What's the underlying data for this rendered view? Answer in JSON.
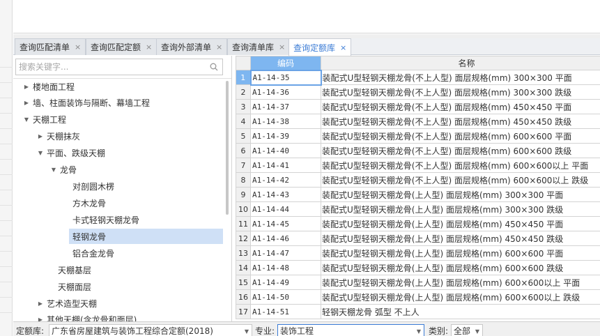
{
  "tabs": [
    {
      "label": "查询匹配清单",
      "close": "×"
    },
    {
      "label": "查询匹配定额",
      "close": "×"
    },
    {
      "label": "查询外部清单",
      "close": "×"
    },
    {
      "label": "查询清单库",
      "close": "×"
    },
    {
      "label": "查询定额库",
      "close": "×",
      "active": true
    }
  ],
  "search": {
    "placeholder": "搜索关键字..."
  },
  "tree": [
    {
      "label": "楼地面工程",
      "expander": "▶"
    },
    {
      "label": "墙、柱面装饰与隔断、幕墙工程",
      "expander": "▶"
    },
    {
      "label": "天棚工程",
      "expander": "▼"
    },
    {
      "label": "天棚抹灰",
      "expander": "▶"
    },
    {
      "label": "平面、跌级天棚",
      "expander": "▼"
    },
    {
      "label": "龙骨",
      "expander": "▼"
    },
    {
      "label": "对剖圆木楞",
      "expander": ""
    },
    {
      "label": "方木龙骨",
      "expander": ""
    },
    {
      "label": "卡式轻钢天棚龙骨",
      "expander": ""
    },
    {
      "label": "轻钢龙骨",
      "expander": "",
      "selected": true
    },
    {
      "label": "铝合金龙骨",
      "expander": ""
    },
    {
      "label": "天棚基层",
      "expander": ""
    },
    {
      "label": "天棚面层",
      "expander": ""
    },
    {
      "label": "艺术造型天棚",
      "expander": "▶"
    },
    {
      "label": "其他天棚(含龙骨和面层)",
      "expander": "▶"
    }
  ],
  "grid": {
    "columns": {
      "code": "编码",
      "name": "名称"
    },
    "rows": [
      {
        "num": "1",
        "code": "A1-14-35",
        "name": "装配式U型轻钢天棚龙骨(不上人型) 面层规格(mm) 300×300 平面"
      },
      {
        "num": "2",
        "code": "A1-14-36",
        "name": "装配式U型轻钢天棚龙骨(不上人型) 面层规格(mm) 300×300 跌级"
      },
      {
        "num": "3",
        "code": "A1-14-37",
        "name": "装配式U型轻钢天棚龙骨(不上人型) 面层规格(mm) 450×450 平面"
      },
      {
        "num": "4",
        "code": "A1-14-38",
        "name": "装配式U型轻钢天棚龙骨(不上人型) 面层规格(mm) 450×450 跌级"
      },
      {
        "num": "5",
        "code": "A1-14-39",
        "name": "装配式U型轻钢天棚龙骨(不上人型) 面层规格(mm) 600×600 平面"
      },
      {
        "num": "6",
        "code": "A1-14-40",
        "name": "装配式U型轻钢天棚龙骨(不上人型) 面层规格(mm) 600×600 跌级"
      },
      {
        "num": "7",
        "code": "A1-14-41",
        "name": "装配式U型轻钢天棚龙骨(不上人型) 面层规格(mm) 600×600以上 平面"
      },
      {
        "num": "8",
        "code": "A1-14-42",
        "name": "装配式U型轻钢天棚龙骨(不上人型) 面层规格(mm) 600×600以上 跌级"
      },
      {
        "num": "9",
        "code": "A1-14-43",
        "name": "装配式U型轻钢天棚龙骨(上人型) 面层规格(mm) 300×300 平面"
      },
      {
        "num": "10",
        "code": "A1-14-44",
        "name": "装配式U型轻钢天棚龙骨(上人型) 面层规格(mm) 300×300 跌级"
      },
      {
        "num": "11",
        "code": "A1-14-45",
        "name": "装配式U型轻钢天棚龙骨(上人型) 面层规格(mm) 450×450 平面"
      },
      {
        "num": "12",
        "code": "A1-14-46",
        "name": "装配式U型轻钢天棚龙骨(上人型) 面层规格(mm) 450×450 跌级"
      },
      {
        "num": "13",
        "code": "A1-14-47",
        "name": "装配式U型轻钢天棚龙骨(上人型) 面层规格(mm) 600×600 平面"
      },
      {
        "num": "14",
        "code": "A1-14-48",
        "name": "装配式U型轻钢天棚龙骨(上人型) 面层规格(mm) 600×600 跌级"
      },
      {
        "num": "15",
        "code": "A1-14-49",
        "name": "装配式U型轻钢天棚龙骨(上人型) 面层规格(mm) 600×600以上 平面"
      },
      {
        "num": "16",
        "code": "A1-14-50",
        "name": "装配式U型轻钢天棚龙骨(上人型) 面层规格(mm) 600×600以上 跌级"
      },
      {
        "num": "17",
        "code": "A1-14-51",
        "name": "轻钢天棚龙骨 弧型 不上人"
      }
    ]
  },
  "bottom": {
    "library_label": "定额库:",
    "library_value": "广东省房屋建筑与装饰工程综合定额(2018)",
    "major_label": "专业:",
    "major_value": "装饰工程",
    "category_label": "类别:",
    "category_value": "全部"
  },
  "icons": {
    "search": "search-icon",
    "expand": "triangle-right-icon",
    "collapse": "triangle-down-icon",
    "dropdown": "caret-down-icon"
  },
  "colors": {
    "accent": "#3a7bd5",
    "header_highlight": "#7eb6f0",
    "selected_row": "#cfe0f6"
  }
}
